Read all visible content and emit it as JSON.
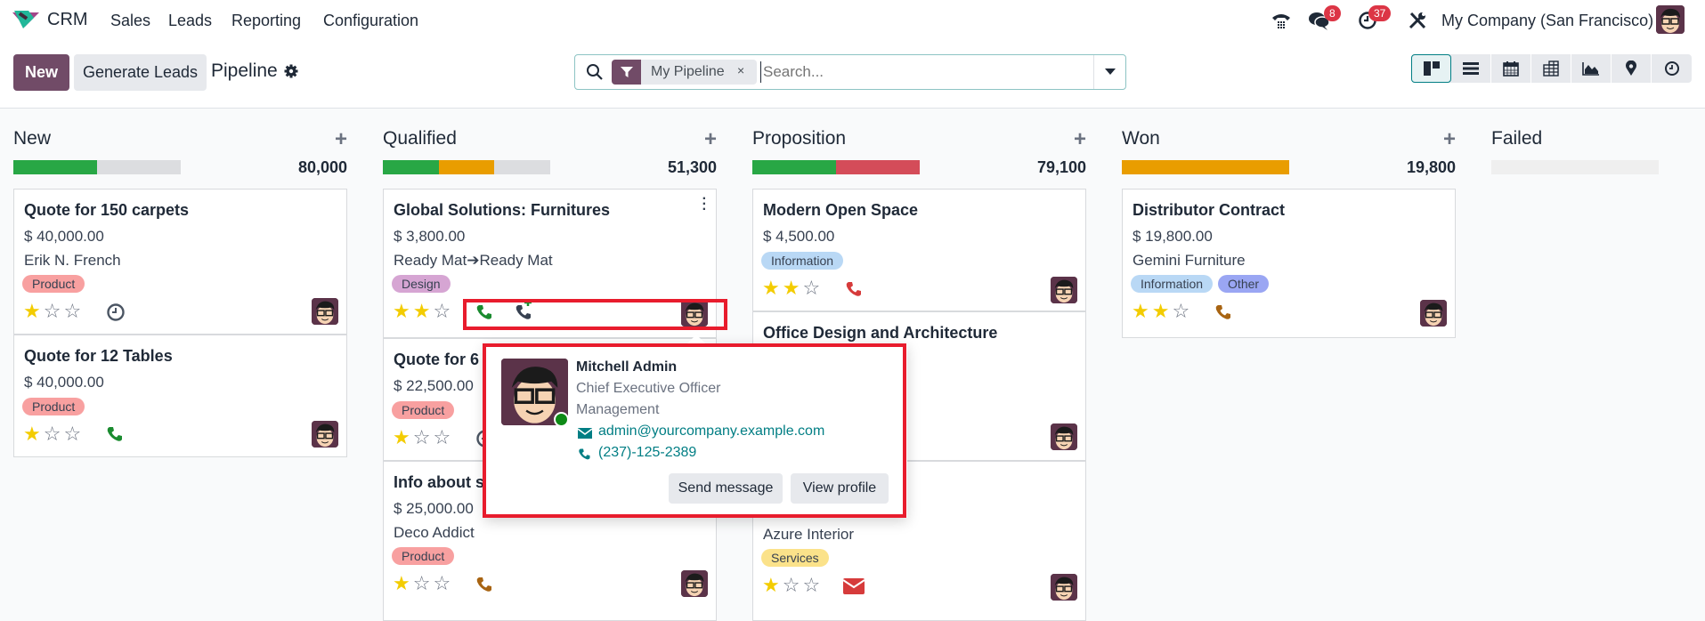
{
  "topbar": {
    "app_name": "CRM",
    "menu": [
      "Sales",
      "Leads",
      "Reporting",
      "Configuration"
    ],
    "messages_badge": "8",
    "activities_badge": "37",
    "company": "My Company (San Francisco)"
  },
  "control_panel": {
    "new_label": "New",
    "generate_label": "Generate Leads",
    "title": "Pipeline",
    "facet_label": "My Pipeline",
    "facet_remove": "×",
    "search_placeholder": "Search...",
    "views": [
      "kanban",
      "list",
      "calendar",
      "pivot",
      "graph",
      "map",
      "activity"
    ],
    "active_view": "kanban"
  },
  "colors": {
    "brand": "#714b67",
    "accent": "#017e84",
    "progress_green": "#28a745",
    "progress_orange": "#e99d00",
    "progress_red": "#d44c59",
    "progress_grey": "#dcdde0",
    "highlight": "#e81c2d"
  },
  "columns": [
    {
      "title": "New",
      "total": "80,000",
      "plus": "+",
      "progress": [
        {
          "color": "green",
          "fraction": 0.5
        }
      ],
      "cards": [
        {
          "title": "Quote for 150 carpets",
          "amount": "$ 40,000.00",
          "partner": "Erik N. French",
          "tags": [
            {
              "label": "Product",
              "color": "#f8a0a0"
            }
          ],
          "stars": 1,
          "activity": "clock"
        },
        {
          "title": "Quote for 12 Tables",
          "amount": "$ 40,000.00",
          "partner": "",
          "tags": [
            {
              "label": "Product",
              "color": "#f8a0a0"
            }
          ],
          "stars": 1,
          "activity": "phone-green"
        }
      ]
    },
    {
      "title": "Qualified",
      "total": "51,300",
      "plus": "+",
      "progress": [
        {
          "color": "green",
          "fraction": 0.333
        },
        {
          "color": "orange",
          "fraction": 0.333
        }
      ],
      "cards": [
        {
          "title": "Global Solutions: Furnitures",
          "amount": "$ 3,800.00",
          "partner": "Ready Mat➔Ready Mat",
          "tags": [
            {
              "label": "Design",
              "color": "#d6a5d3"
            }
          ],
          "stars": 2,
          "activity": "phone-green",
          "extra_activity": "phone-plus"
        },
        {
          "title": "Quote for 6",
          "amount": "$ 22,500.00",
          "partner": "",
          "tags": [
            {
              "label": "Product",
              "color": "#f8a0a0"
            }
          ],
          "stars": 1,
          "activity": "clock"
        },
        {
          "title": "Info about s",
          "amount": "$ 25,000.00",
          "partner": "Deco Addict",
          "tags": [
            {
              "label": "Product",
              "color": "#f8a0a0"
            }
          ],
          "stars": 1,
          "activity": "phone-orange"
        }
      ]
    },
    {
      "title": "Proposition",
      "total": "79,100",
      "plus": "+",
      "progress": [
        {
          "color": "green",
          "fraction": 0.5
        },
        {
          "color": "red",
          "fraction": 0.5
        }
      ],
      "cards": [
        {
          "title": "Modern Open Space",
          "amount": "$ 4,500.00",
          "partner": "",
          "tags": [
            {
              "label": "Information",
              "color": "#b9d8f5"
            }
          ],
          "stars": 2,
          "activity": "phone-red"
        },
        {
          "title": "Office Design and Architecture",
          "amount": "",
          "partner": "",
          "tags": [],
          "stars": 0,
          "activity": ""
        },
        {
          "title": "",
          "amount": "",
          "partner": "Azure Interior",
          "tags": [
            {
              "label": "Services",
              "color": "#fbe28a"
            }
          ],
          "stars": 1,
          "activity": "envelope-red"
        }
      ]
    },
    {
      "title": "Won",
      "total": "19,800",
      "plus": "+",
      "progress": [
        {
          "color": "orange",
          "fraction": 1.0
        }
      ],
      "cards": [
        {
          "title": "Distributor Contract",
          "amount": "$ 19,800.00",
          "partner": "Gemini Furniture",
          "tags": [
            {
              "label": "Information",
              "color": "#b9d8f5"
            },
            {
              "label": "Other",
              "color": "#9aa6f3"
            }
          ],
          "stars": 2,
          "activity": "phone-orange"
        }
      ]
    },
    {
      "title": "Failed",
      "total": "",
      "plus": "",
      "progress": [],
      "cards": []
    }
  ],
  "popover": {
    "name": "Mitchell Admin",
    "job": "Chief Executive Officer",
    "department": "Management",
    "email": "admin@yourcompany.example.com",
    "phone": "(237)-125-2389",
    "send_label": "Send message",
    "profile_label": "View profile",
    "status": "online"
  }
}
